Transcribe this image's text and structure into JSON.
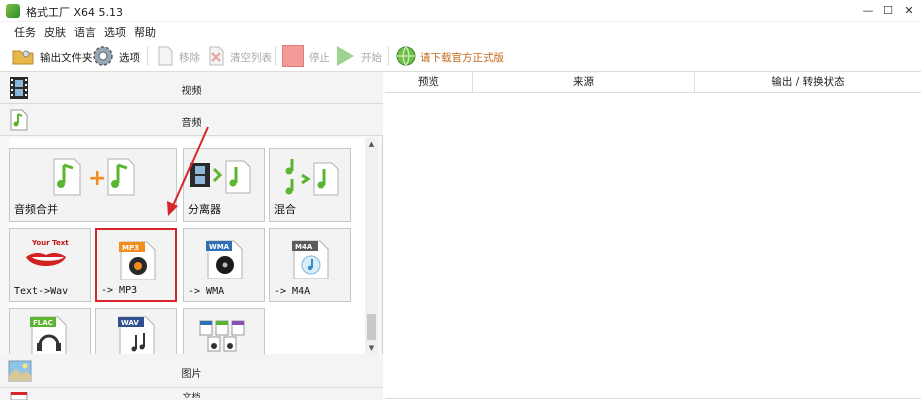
{
  "window": {
    "title": "格式工厂 X64 5.13",
    "controls": {
      "minimize": "—",
      "maximize": "☐",
      "close": "✕"
    }
  },
  "menu": [
    {
      "label": "任务"
    },
    {
      "label": "皮肤"
    },
    {
      "label": "语言"
    },
    {
      "label": "选项"
    },
    {
      "label": "帮助"
    }
  ],
  "toolbar": {
    "output_folder": "输出文件夹",
    "options": "选项",
    "remove": "移除",
    "clear_list": "清空列表",
    "stop": "停止",
    "start": "开始",
    "download": "请下载官方正式版"
  },
  "categories": {
    "video": "视频",
    "audio": "音频",
    "image": "图片",
    "document": "文档"
  },
  "audio_tools": [
    {
      "label": "音频合并"
    },
    {
      "label": "分离器"
    },
    {
      "label": "混合"
    },
    {
      "label": "Text->Wav",
      "badge": "Your Text"
    },
    {
      "label": "-> MP3",
      "badge": "MP3"
    },
    {
      "label": "-> WMA",
      "badge": "WMA"
    },
    {
      "label": "-> M4A",
      "badge": "M4A"
    },
    {
      "label": "",
      "badge": "FLAC"
    },
    {
      "label": "",
      "badge": "WAV"
    },
    {
      "label": ""
    }
  ],
  "task_table": {
    "columns": [
      "预览",
      "来源",
      "输出 / 转换状态"
    ]
  },
  "colors": {
    "accent_red": "#d6262b",
    "green": "#5cb531",
    "stop_red": "#f07f7f"
  }
}
